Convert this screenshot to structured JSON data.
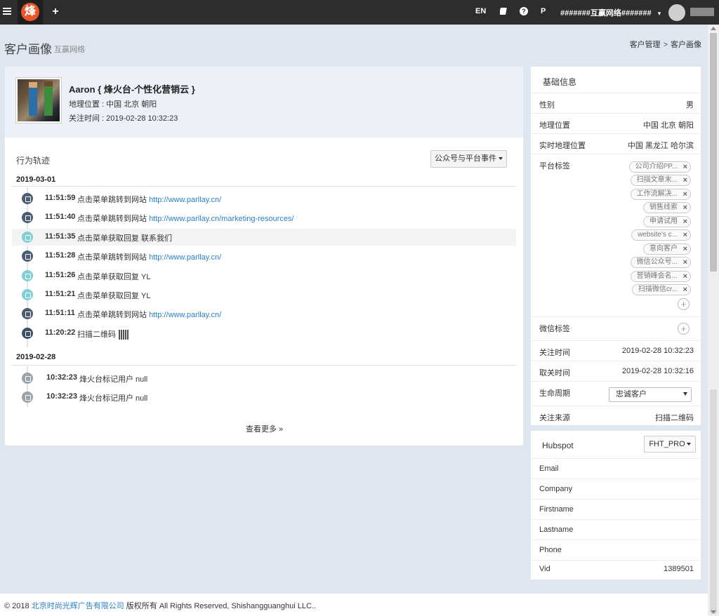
{
  "topbar": {
    "logo_char": "烽",
    "lang": "EN",
    "help": "?",
    "p": "P",
    "account": "#######互赢网络#######",
    "account_caret": "▾"
  },
  "header": {
    "title": "客户画像",
    "subtitle": "互赢网络",
    "breadcrumb": [
      "客户管理",
      "客户画像"
    ],
    "breadcrumb_sep": ">"
  },
  "profile": {
    "name": "Aaron { 烽火台-个性化营销云 }",
    "location": "地理位置 : 中国 北京 朝阳",
    "follow_time": "关注时间 : 2019-02-28 10:32:23"
  },
  "timeline": {
    "title": "行为轨迹",
    "filter_label": "公众号与平台事件",
    "more_label": "查看更多 »",
    "groups": [
      {
        "date": "2019-03-01",
        "events": [
          {
            "time": "11:51:59",
            "text": "点击菜单跳转到网站",
            "link": "http://www.parllay.cn/",
            "icon": "link-icon"
          },
          {
            "time": "11:51:40",
            "text": "点击菜单跳转到网站",
            "link": "http://www.parllay.cn/marketing-resources/",
            "icon": "link-icon"
          },
          {
            "time": "11:51:35",
            "text": "点击菜单获取回复 联系我们",
            "link": "",
            "icon": "reply-icon"
          },
          {
            "time": "11:51:28",
            "text": "点击菜单跳转到网站",
            "link": "http://www.parllay.cn/",
            "icon": "link-icon"
          },
          {
            "time": "11:51:26",
            "text": "点击菜单获取回复 YL",
            "link": "",
            "icon": "reply-icon"
          },
          {
            "time": "11:51:21",
            "text": "点击菜单获取回复 YL",
            "link": "",
            "icon": "reply-icon"
          },
          {
            "time": "11:51:11",
            "text": "点击菜单跳转到网站",
            "link": "http://www.parllay.cn/",
            "icon": "link-icon"
          },
          {
            "time": "11:20:22",
            "text": "扫描二维码",
            "link": "",
            "icon": "qrcode-icon"
          }
        ]
      },
      {
        "date": "2019-02-28",
        "events": [
          {
            "time": "10:32:23",
            "text": "烽火台标记用户 null",
            "link": "",
            "icon": "globe-icon"
          },
          {
            "time": "10:32:23",
            "text": "烽火台标记用户 null",
            "link": "",
            "icon": "globe-icon"
          }
        ]
      }
    ]
  },
  "basic_info": {
    "title": "基础信息",
    "rows": {
      "gender": {
        "k": "性别",
        "v": "男"
      },
      "location": {
        "k": "地理位置",
        "v": "中国 北京 朝阳"
      },
      "realtime_location": {
        "k": "实时地理位置",
        "v": "中国 黑龙江 哈尔滨"
      },
      "platform_tags_label": "平台标签",
      "wechat_tags_label": "微信标签",
      "follow_time": {
        "k": "关注时间",
        "v": "2019-02-28 10:32:23"
      },
      "unfollow_time": {
        "k": "取关时间",
        "v": "2019-02-28 10:32:16"
      },
      "lifecycle": {
        "k": "生命周期",
        "v": "忠诚客户"
      },
      "source": {
        "k": "关注来源",
        "v": "扫描二维码"
      }
    },
    "platform_tags": [
      "公司介绍PP...",
      "扫描文章末...",
      "工作流解决...",
      "销售线索",
      "申请试用",
      "website's c...",
      "意向客户",
      "微信公众号...",
      "营销峰会名...",
      "扫描微信cr..."
    ],
    "tag_remove": "×",
    "add": "+"
  },
  "hubspot": {
    "title": "Hubspot",
    "button": "FHT_PRO",
    "rows": [
      {
        "k": "Email",
        "v": ""
      },
      {
        "k": "Company",
        "v": ""
      },
      {
        "k": "Firstname",
        "v": ""
      },
      {
        "k": "Lastname",
        "v": ""
      },
      {
        "k": "Phone",
        "v": ""
      },
      {
        "k": "Vid",
        "v": "1389501"
      }
    ]
  },
  "footer": {
    "prefix": "© 2018 ",
    "company": "北京时尚光辉广告有限公司",
    "suffix": " 版权所有 All Rights Reserved, Shishangguanghui LLC.."
  }
}
